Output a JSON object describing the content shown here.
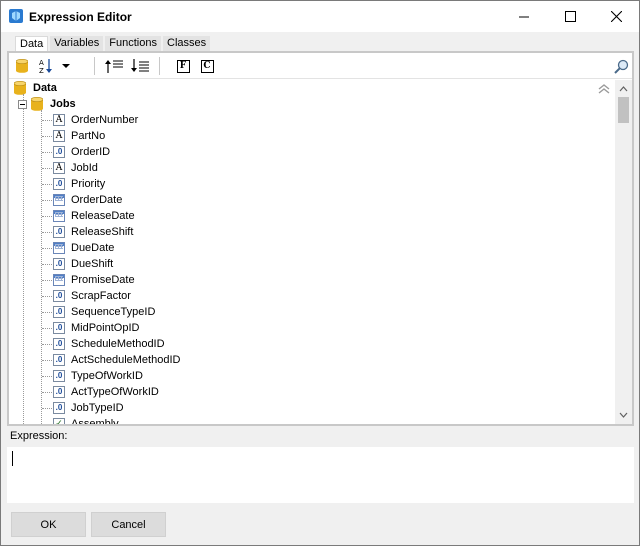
{
  "window": {
    "title": "Expression Editor"
  },
  "tabs": [
    {
      "label": "Data",
      "active": true
    },
    {
      "label": "Variables",
      "active": false
    },
    {
      "label": "Functions",
      "active": false
    },
    {
      "label": "Classes",
      "active": false
    }
  ],
  "toolbar": {
    "items": [
      "database-icon",
      "sort-az-icon",
      "dropdown-arrow-icon",
      "move-top-icon",
      "move-bottom-icon",
      "function-icon",
      "class-icon"
    ],
    "function_label": "F",
    "class_label": "C",
    "search": {
      "value": "",
      "placeholder": ""
    }
  },
  "tree": {
    "root": {
      "label": "Data",
      "icon": "database-icon"
    },
    "group": {
      "label": "Jobs",
      "icon": "database-icon"
    },
    "fields": [
      {
        "label": "OrderNumber",
        "type": "text"
      },
      {
        "label": "PartNo",
        "type": "text"
      },
      {
        "label": "OrderID",
        "type": "numeric"
      },
      {
        "label": "JobId",
        "type": "text"
      },
      {
        "label": "Priority",
        "type": "numeric"
      },
      {
        "label": "OrderDate",
        "type": "date"
      },
      {
        "label": "ReleaseDate",
        "type": "date"
      },
      {
        "label": "ReleaseShift",
        "type": "numeric"
      },
      {
        "label": "DueDate",
        "type": "date"
      },
      {
        "label": "DueShift",
        "type": "numeric"
      },
      {
        "label": "PromiseDate",
        "type": "date"
      },
      {
        "label": "ScrapFactor",
        "type": "numeric"
      },
      {
        "label": "SequenceTypeID",
        "type": "numeric"
      },
      {
        "label": "MidPointOpID",
        "type": "numeric"
      },
      {
        "label": "ScheduleMethodID",
        "type": "numeric"
      },
      {
        "label": "ActScheduleMethodID",
        "type": "numeric"
      },
      {
        "label": "TypeOfWorkID",
        "type": "numeric"
      },
      {
        "label": "ActTypeOfWorkID",
        "type": "numeric"
      },
      {
        "label": "JobTypeID",
        "type": "numeric"
      },
      {
        "label": "Assembly",
        "type": "boolean"
      }
    ],
    "type_glyphs": {
      "text": "A",
      "numeric": ".0",
      "date": "",
      "boolean": "✓"
    }
  },
  "expression": {
    "label": "Expression:",
    "value": ""
  },
  "buttons": {
    "ok": "OK",
    "cancel": "Cancel"
  },
  "colors": {
    "database": "#e8b21c",
    "window_bg": "#f0f0f0",
    "accent": "#4f7fc7"
  }
}
